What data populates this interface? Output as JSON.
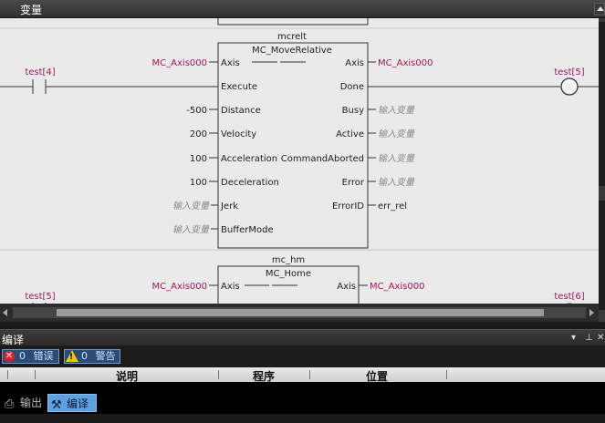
{
  "top_panel": {
    "title": "变量"
  },
  "ladder": {
    "blocks": [
      {
        "instance": "mcrelt",
        "type": "MC_MoveRelative",
        "inputs": [
          {
            "arg": "MC_Axis000",
            "pin": "Axis",
            "kind": "var"
          },
          {
            "arg": "",
            "pin": "Execute",
            "kind": "none"
          },
          {
            "arg": "-500",
            "pin": "Distance",
            "kind": "num"
          },
          {
            "arg": "200",
            "pin": "Velocity",
            "kind": "num"
          },
          {
            "arg": "100",
            "pin": "Acceleration",
            "kind": "num"
          },
          {
            "arg": "100",
            "pin": "Deceleration",
            "kind": "num"
          },
          {
            "arg": "输入变量",
            "pin": "Jerk",
            "kind": "placeholder"
          },
          {
            "arg": "输入变量",
            "pin": "BufferMode",
            "kind": "placeholder"
          }
        ],
        "outputs": [
          {
            "pin": "Axis",
            "arg": "MC_Axis000",
            "kind": "var"
          },
          {
            "pin": "Done",
            "arg": "",
            "kind": "none"
          },
          {
            "pin": "Busy",
            "arg": "输入变量",
            "kind": "placeholder"
          },
          {
            "pin": "Active",
            "arg": "输入变量",
            "kind": "placeholder"
          },
          {
            "pin": "CommandAborted",
            "arg": "输入变量",
            "kind": "placeholder"
          },
          {
            "pin": "Error",
            "arg": "输入变量",
            "kind": "placeholder"
          },
          {
            "pin": "ErrorID",
            "arg": "err_rel",
            "kind": "num"
          }
        ]
      },
      {
        "instance": "mc_hm",
        "type": "MC_Home",
        "inputs": [
          {
            "arg": "MC_Axis000",
            "pin": "Axis",
            "kind": "var"
          }
        ],
        "outputs": [
          {
            "pin": "Axis",
            "arg": "MC_Axis000",
            "kind": "var"
          }
        ]
      }
    ],
    "contacts": [
      {
        "name": "test[4]"
      },
      {
        "name": "test[5]"
      }
    ],
    "coils": [
      {
        "name": "test[5]"
      },
      {
        "name": "test[6]"
      }
    ]
  },
  "compile_panel": {
    "title": "编译",
    "filters": [
      {
        "count": "0",
        "label": "错误",
        "icon": "error-icon"
      },
      {
        "count": "0",
        "label": "警告",
        "icon": "warning-icon"
      }
    ],
    "columns": [
      "说明",
      "程序",
      "位置"
    ],
    "header_icons": [
      "dropdown-icon",
      "pin-icon",
      "close-icon"
    ]
  },
  "bottom_tabs": [
    {
      "label": "输出",
      "icon": "output-icon",
      "active": false
    },
    {
      "label": "编译",
      "icon": "hammer-icon",
      "active": true
    }
  ]
}
